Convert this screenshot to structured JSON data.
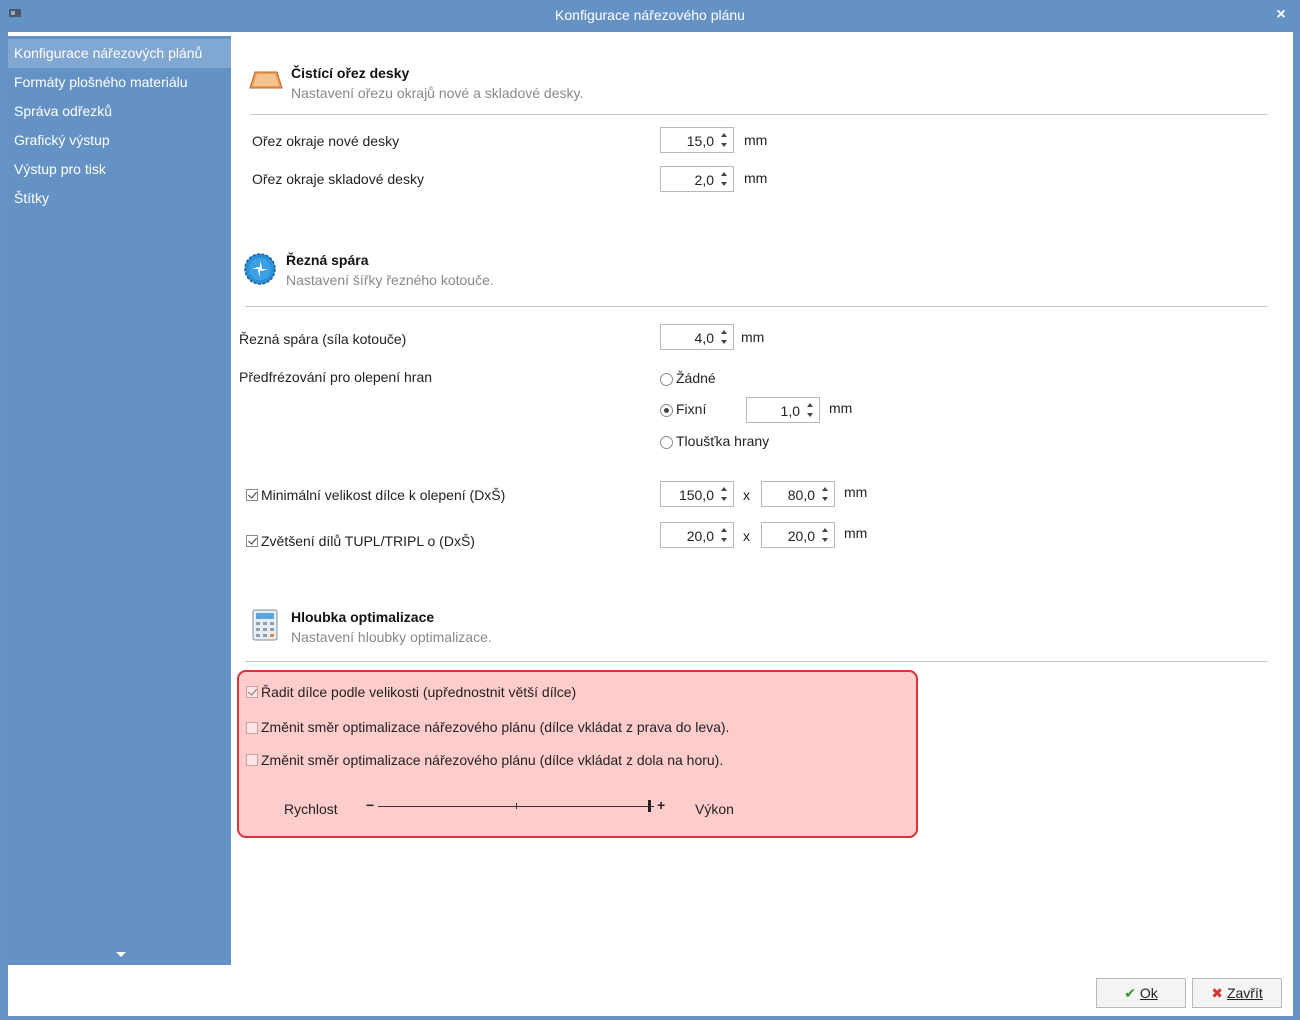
{
  "window": {
    "title": "Konfigurace nářezového plánu",
    "close_glyph": "×"
  },
  "sidebar": {
    "items": [
      {
        "label": "Konfigurace nářezových plánů",
        "active": true
      },
      {
        "label": "Formáty plošného materiálu"
      },
      {
        "label": "Správa odřezků"
      },
      {
        "label": "Grafický výstup"
      },
      {
        "label": "Výstup pro tisk"
      },
      {
        "label": "Štítky"
      }
    ]
  },
  "section_trim": {
    "title": "Čistící ořez desky",
    "subtitle": "Nastavení ořezu okrajů nové a skladové desky.",
    "icon": "board-trim-icon",
    "fields": [
      {
        "label": "Ořez okraje nové desky",
        "value": "15,0",
        "unit": "mm"
      },
      {
        "label": "Ořez okraje skladové desky",
        "value": "2,0",
        "unit": "mm"
      }
    ]
  },
  "section_kerf": {
    "title": "Řezná spára",
    "subtitle": "Nastavení šířky řezného kotouče.",
    "icon": "saw-blade-icon",
    "kerf": {
      "label": "Řezná spára (síla kotouče)",
      "value": "4,0",
      "unit": "mm"
    },
    "premill": {
      "label": "Předfrézování pro olepení hran",
      "options": [
        "Žádné",
        "Fixní",
        "Tloušťka hrany"
      ],
      "selected": "Fixní",
      "fixed_value": "1,0",
      "unit": "mm"
    },
    "min_size": {
      "label": "Minimální velikost dílce k olepení (DxŠ)",
      "checked": true,
      "d": "150,0",
      "s": "80,0",
      "x": "x",
      "unit": "mm"
    },
    "tupl": {
      "label": "Zvětšení dílů TUPL/TRIPL o (DxŠ)",
      "checked": true,
      "d": "20,0",
      "s": "20,0",
      "x": "x",
      "unit": "mm"
    }
  },
  "section_depth": {
    "title": "Hloubka optimalizace",
    "subtitle": "Nastavení hloubky optimalizace.",
    "icon": "calculator-icon",
    "options": [
      {
        "label": "Řadit dílce podle velikosti (upřednostnit větší dílce)",
        "checked": true
      },
      {
        "label": "Změnit směr optimalizace nářezového plánu (dílce vkládat z prava do leva).",
        "checked": false
      },
      {
        "label": "Změnit směr optimalizace nářezového plánu (dílce vkládat z dola na horu).",
        "checked": false
      }
    ],
    "slider": {
      "left_label": "Rychlost",
      "right_label": "Výkon",
      "minus": "−",
      "plus": "+",
      "level": 1.0
    }
  },
  "buttons": {
    "ok": {
      "label": "Ok",
      "icon": "checkmark-icon",
      "color": "#2e9a2e"
    },
    "close": {
      "label": "Zavřít",
      "icon": "x-icon",
      "color": "#d9322f"
    }
  },
  "colors": {
    "accent_blue": "#6592c4",
    "highlight_fill": "#ffcccc",
    "highlight_border": "#e0303b"
  }
}
